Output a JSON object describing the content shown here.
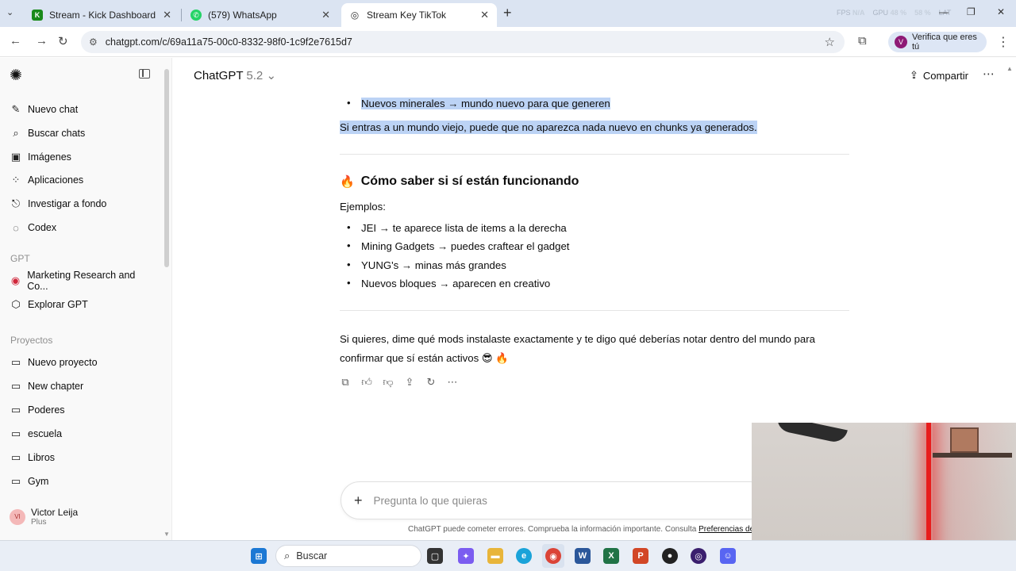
{
  "browser": {
    "tabs": [
      {
        "label": "Stream - Kick Dashboard",
        "fav": "K",
        "color": "#1a8a1a"
      },
      {
        "label": "(579) WhatsApp",
        "fav": "✆",
        "color": "#25d366"
      },
      {
        "label": "Stream Key TikTok",
        "fav": "◎",
        "color": "#4a4a4a"
      }
    ],
    "perf": {
      "fps_label": "FPS",
      "fps": "N/A",
      "gpu_label": "GPU",
      "gpu": "48 %",
      "mid": "58 %",
      "lat": "LAT"
    },
    "url": "chatgpt.com/c/69a11a75-00c0-8332-98f0-1c9f2e7615d7",
    "verify_label": "Verifica que eres tú",
    "verify_avatar": "V"
  },
  "sidebar": {
    "items": [
      {
        "label": "Nuevo chat",
        "icon": "edit-icon",
        "glyph": "✎"
      },
      {
        "label": "Buscar chats",
        "icon": "search-icon",
        "glyph": "⌕"
      },
      {
        "label": "Imágenes",
        "icon": "image-icon",
        "glyph": "▣"
      },
      {
        "label": "Aplicaciones",
        "icon": "apps-icon",
        "glyph": "⁘"
      },
      {
        "label": "Investigar a fondo",
        "icon": "research-icon",
        "glyph": "⎋"
      },
      {
        "label": "Codex",
        "icon": "codex-icon",
        "glyph": "◌"
      }
    ],
    "gpt_section": "GPT",
    "gpts": [
      {
        "label": "Marketing Research and Co...",
        "icon": "marketing-gpt-icon",
        "glyph": "◉"
      },
      {
        "label": "Explorar GPT",
        "icon": "explore-icon",
        "glyph": "⬡"
      }
    ],
    "projects_section": "Proyectos",
    "projects": [
      {
        "label": "Nuevo proyecto",
        "icon": "new-folder-icon",
        "glyph": "▭"
      },
      {
        "label": "New chapter",
        "icon": "folder-icon",
        "glyph": "▭"
      },
      {
        "label": "Poderes",
        "icon": "folder-icon",
        "glyph": "▭"
      },
      {
        "label": "escuela",
        "icon": "folder-icon",
        "glyph": "▭"
      },
      {
        "label": "Libros",
        "icon": "folder-icon",
        "glyph": "▭"
      },
      {
        "label": "Gym",
        "icon": "folder-icon",
        "glyph": "▭"
      }
    ],
    "user": {
      "name": "Victor Leija",
      "plan": "Plus",
      "initials": "VI"
    }
  },
  "header": {
    "model": "ChatGPT",
    "version": "5.2",
    "share": "Compartir"
  },
  "message": {
    "top_bullet": "Nuevos minerales → mundo nuevo para que generen",
    "top_note": "Si entras a un mundo viejo, puede que no aparezca nada nuevo en chunks ya generados.",
    "heading": "Cómo saber si sí están funcionando",
    "examples_label": "Ejemplos:",
    "examples": [
      "JEI → te aparece lista de items a la derecha",
      "Mining Gadgets → puedes craftear el gadget",
      "YUNG's → minas más grandes",
      "Nuevos bloques → aparecen en creativo"
    ],
    "closing_1": "Si quieres, dime qué mods instalaste exactamente y te digo qué deberías notar dentro del mundo para",
    "closing_2": "confirmar que sí están activos 😎 🔥"
  },
  "composer": {
    "placeholder": "Pregunta lo que quieras"
  },
  "disclaimer": {
    "text": "ChatGPT puede cometer errores. Comprueba la información importante. Consulta ",
    "link": "Preferencias de"
  },
  "taskbar": {
    "search": "Buscar"
  }
}
